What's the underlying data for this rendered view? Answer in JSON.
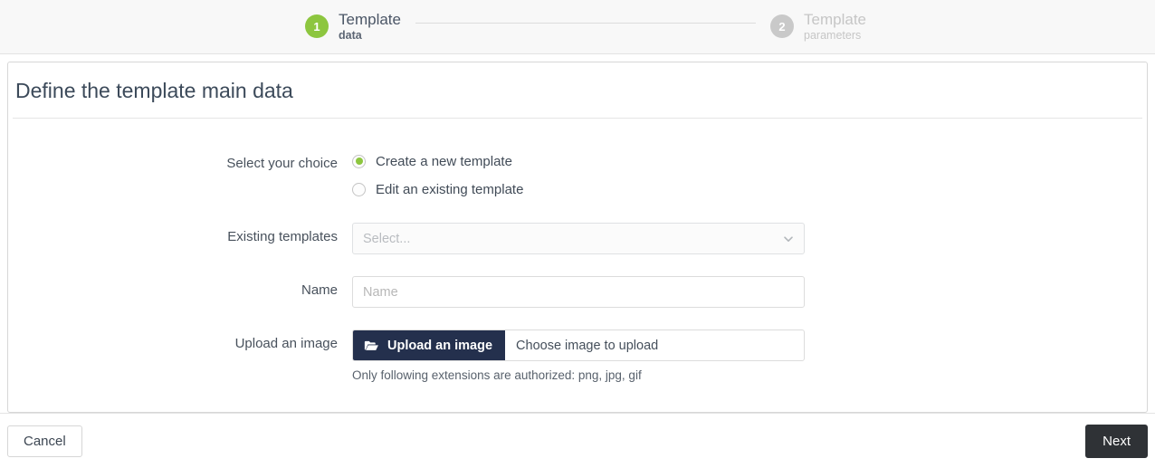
{
  "wizard": {
    "steps": [
      {
        "number": "1",
        "title": "Template",
        "subtitle": "data",
        "state": "active"
      },
      {
        "number": "2",
        "title": "Template",
        "subtitle": "parameters",
        "state": "inactive"
      }
    ],
    "active_color": "#8dc63f",
    "inactive_color": "#c9c9c9"
  },
  "page": {
    "title": "Define the template main data"
  },
  "form": {
    "choice": {
      "label": "Select your choice",
      "options": [
        {
          "label": "Create a new template",
          "selected": true
        },
        {
          "label": "Edit an existing template",
          "selected": false
        }
      ]
    },
    "existing_templates": {
      "label": "Existing templates",
      "placeholder": "Select...",
      "value": "Select...",
      "icon": "chevron-down-icon"
    },
    "name": {
      "label": "Name",
      "placeholder": "Name",
      "value": ""
    },
    "upload": {
      "label": "Upload an image",
      "button_label": "Upload an image",
      "button_icon": "folder-open-icon",
      "button_color": "#24304d",
      "filename_placeholder": "Choose image to upload",
      "help_text": "Only following extensions are authorized: png, jpg, gif"
    }
  },
  "footer": {
    "cancel_label": "Cancel",
    "next_label": "Next",
    "next_color": "#2f3236"
  }
}
